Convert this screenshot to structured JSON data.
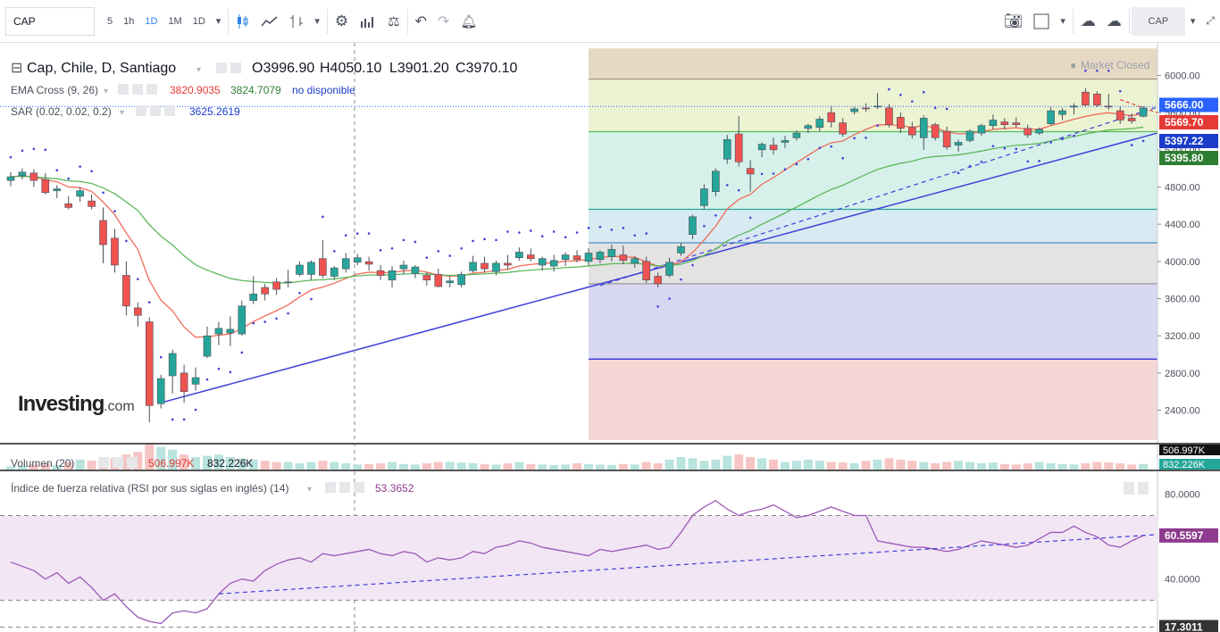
{
  "toolbar": {
    "symbol": "CAP",
    "intervals": [
      "5",
      "1h",
      "1D",
      "1M",
      "1D"
    ],
    "active_interval": "1D",
    "right_symbol": "CAP",
    "icons": [
      "candles-icon",
      "line-chart-icon",
      "bars-icon",
      "dropdown-icon",
      "gear-icon",
      "indicators-icon",
      "compare-icon",
      "undo-icon",
      "redo-icon",
      "alert-icon",
      "camera-icon",
      "layout-icon",
      "cloud-load-icon",
      "cloud-save-icon",
      "fullscreen-icon"
    ]
  },
  "legend": {
    "title": "Cap, Chile, D, Santiago",
    "ohlc": {
      "o": "O3996.90",
      "h": "H4050.10",
      "l": "L3901.20",
      "c": "C3970.10"
    },
    "ema_label": "EMA Cross (9, 26)",
    "ema_val1": "3820.9035",
    "ema_val2": "3824.7079",
    "ema_val3": "no disponible",
    "sar_label": "SAR (0.02, 0.02, 0.2)",
    "sar_val": "3625.2619",
    "market_status": "Market Closed",
    "watermark_brand": "Investing",
    "watermark_suffix": ".com"
  },
  "volume_legend": {
    "label": "Volumen (20)",
    "val1": "506.997K",
    "val2": "832.226K"
  },
  "rsi_legend": {
    "label": "Índice de fuerza relativa (RSI por sus siglas en inglés) (14)",
    "value": "53.3652"
  },
  "colors": {
    "up": "#26a69a",
    "down": "#ef5350",
    "ema_fast": "#ef6c5a",
    "ema_slow": "#5cb85c",
    "sar": "#3f3fd9",
    "trend": "#3f3fd9",
    "rsi": "#9b59b6"
  },
  "chart_data": [
    {
      "type": "candlestick",
      "title": "Cap, Chile, D, Santiago",
      "y_axis_ticks": [
        "6000.00",
        "5600.00",
        "5200.00",
        "4800.00",
        "4400.00",
        "4000.00",
        "3600.00",
        "3200.00",
        "2800.00",
        "2400.00"
      ],
      "y_tick_values": [
        6000,
        5600,
        5200,
        4800,
        4400,
        4000,
        3600,
        3200,
        2800,
        2400
      ],
      "ylim": [
        2050,
        6350
      ],
      "price_labels": [
        {
          "text": "5666.00",
          "value": 5666,
          "color": "#2962ff"
        },
        {
          "text": "5569.70",
          "value": 5569.7,
          "color": "#e53935"
        },
        {
          "text": "5397.22",
          "value": 5397.22,
          "color": "#1a3cc9"
        },
        {
          "text": "5395.80",
          "value": 5395.8,
          "color": "#2e7d32"
        }
      ],
      "candles": [
        [
          4870,
          4960,
          4810,
          4910
        ],
        [
          4920,
          5000,
          4880,
          4960
        ],
        [
          4950,
          4990,
          4800,
          4870
        ],
        [
          4880,
          4950,
          4720,
          4740
        ],
        [
          4760,
          4820,
          4680,
          4780
        ],
        [
          4620,
          4700,
          4560,
          4580
        ],
        [
          4700,
          4800,
          4640,
          4760
        ],
        [
          4650,
          4720,
          4560,
          4590
        ],
        [
          4440,
          4580,
          3980,
          4180
        ],
        [
          4250,
          4350,
          3880,
          3960
        ],
        [
          3850,
          4000,
          3420,
          3520
        ],
        [
          3500,
          3560,
          3300,
          3420
        ],
        [
          3350,
          3400,
          2270,
          2450
        ],
        [
          2470,
          2780,
          2420,
          2740
        ],
        [
          2770,
          3050,
          2580,
          3010
        ],
        [
          2800,
          2890,
          2480,
          2600
        ],
        [
          2680,
          2860,
          2610,
          2750
        ],
        [
          2980,
          3300,
          2960,
          3200
        ],
        [
          3220,
          3350,
          3100,
          3280
        ],
        [
          3230,
          3410,
          3090,
          3270
        ],
        [
          3220,
          3580,
          3200,
          3520
        ],
        [
          3580,
          3840,
          3540,
          3650
        ],
        [
          3720,
          3760,
          3580,
          3650
        ],
        [
          3780,
          3820,
          3640,
          3700
        ],
        [
          3770,
          3910,
          3720,
          3780
        ],
        [
          3860,
          4000,
          3840,
          3960
        ],
        [
          3860,
          4010,
          3800,
          3990
        ],
        [
          4030,
          4230,
          3820,
          3850
        ],
        [
          3840,
          3950,
          3800,
          3930
        ],
        [
          3920,
          4090,
          3880,
          4030
        ],
        [
          3990,
          4080,
          3960,
          4040
        ],
        [
          3997,
          4050,
          3901,
          3970
        ],
        [
          3900,
          3960,
          3800,
          3850
        ],
        [
          3800,
          3950,
          3720,
          3900
        ],
        [
          3920,
          4010,
          3860,
          3960
        ],
        [
          3870,
          3960,
          3820,
          3940
        ],
        [
          3850,
          3880,
          3740,
          3800
        ],
        [
          3860,
          3920,
          3720,
          3730
        ],
        [
          3770,
          3840,
          3720,
          3790
        ],
        [
          3750,
          3890,
          3720,
          3860
        ],
        [
          3900,
          4060,
          3880,
          3990
        ],
        [
          3980,
          4050,
          3880,
          3920
        ],
        [
          3890,
          4010,
          3850,
          3980
        ],
        [
          3980,
          4070,
          3910,
          3960
        ],
        [
          4040,
          4150,
          4010,
          4100
        ],
        [
          4070,
          4140,
          4000,
          4030
        ],
        [
          3960,
          4050,
          3900,
          4030
        ],
        [
          3950,
          4070,
          3890,
          4010
        ],
        [
          4020,
          4100,
          3950,
          4070
        ],
        [
          4060,
          4120,
          3990,
          4020
        ],
        [
          4000,
          4140,
          3960,
          4090
        ],
        [
          4020,
          4120,
          3980,
          4100
        ],
        [
          4050,
          4180,
          4000,
          4130
        ],
        [
          4070,
          4170,
          3970,
          4010
        ],
        [
          3980,
          4060,
          3930,
          4030
        ],
        [
          4000,
          4050,
          3770,
          3800
        ],
        [
          3840,
          3880,
          3720,
          3760
        ],
        [
          3850,
          4040,
          3830,
          3990
        ],
        [
          4090,
          4200,
          4060,
          4160
        ],
        [
          4290,
          4500,
          4240,
          4480
        ],
        [
          4600,
          4830,
          4560,
          4780
        ],
        [
          4750,
          5000,
          4700,
          4970
        ],
        [
          5100,
          5360,
          5050,
          5310
        ],
        [
          5370,
          5560,
          5020,
          5070
        ],
        [
          5000,
          5090,
          4750,
          4940
        ],
        [
          5200,
          5280,
          5120,
          5260
        ],
        [
          5250,
          5330,
          5150,
          5200
        ],
        [
          5280,
          5350,
          5220,
          5300
        ],
        [
          5330,
          5410,
          5300,
          5380
        ],
        [
          5430,
          5480,
          5380,
          5460
        ],
        [
          5440,
          5560,
          5400,
          5530
        ],
        [
          5600,
          5670,
          5440,
          5500
        ],
        [
          5490,
          5540,
          5340,
          5370
        ],
        [
          5610,
          5660,
          5580,
          5640
        ],
        [
          5650,
          5700,
          5610,
          5640
        ],
        [
          5660,
          5810,
          5640,
          5670
        ],
        [
          5650,
          5690,
          5440,
          5470
        ],
        [
          5550,
          5600,
          5380,
          5430
        ],
        [
          5440,
          5500,
          5320,
          5360
        ],
        [
          5330,
          5570,
          5200,
          5540
        ],
        [
          5470,
          5490,
          5300,
          5330
        ],
        [
          5400,
          5450,
          5200,
          5230
        ],
        [
          5250,
          5310,
          5180,
          5280
        ],
        [
          5300,
          5420,
          5280,
          5400
        ],
        [
          5380,
          5480,
          5350,
          5460
        ],
        [
          5460,
          5580,
          5420,
          5520
        ],
        [
          5500,
          5540,
          5420,
          5470
        ],
        [
          5490,
          5550,
          5440,
          5470
        ],
        [
          5430,
          5470,
          5330,
          5360
        ],
        [
          5380,
          5440,
          5360,
          5420
        ],
        [
          5480,
          5660,
          5460,
          5620
        ],
        [
          5580,
          5650,
          5520,
          5620
        ],
        [
          5660,
          5700,
          5580,
          5670
        ],
        [
          5820,
          5860,
          5660,
          5680
        ],
        [
          5800,
          5830,
          5660,
          5680
        ],
        [
          5670,
          5800,
          5630,
          5660
        ],
        [
          5620,
          5670,
          5480,
          5520
        ],
        [
          5540,
          5590,
          5480,
          5510
        ],
        [
          5560,
          5670,
          5550,
          5650
        ]
      ],
      "rsi_ticks": [
        "80.0000",
        "40.0000"
      ],
      "rsi_tick_values": [
        80,
        40
      ],
      "rsi_levels": [
        70,
        30
      ],
      "rsi_ylim": [
        15,
        90
      ],
      "rsi_labels": [
        {
          "text": "60.5597",
          "value": 60.56,
          "color": "#8e3a8e"
        },
        {
          "text": "17.3011",
          "value": 17.3,
          "color": "#333333"
        }
      ],
      "rsi": [
        48,
        46,
        44,
        40,
        43,
        38,
        41,
        36,
        30,
        33,
        27,
        22,
        20,
        19,
        24,
        25,
        24,
        26,
        33,
        38,
        40,
        39,
        44,
        47,
        49,
        50,
        48,
        52,
        51,
        52,
        53,
        54,
        52,
        51,
        53,
        52,
        48,
        50,
        49,
        50,
        53,
        52,
        55,
        56,
        58,
        57,
        55,
        54,
        53,
        52,
        51,
        54,
        53,
        54,
        55,
        56,
        54,
        55,
        62,
        70,
        74,
        77,
        73,
        70,
        72,
        73,
        75,
        72,
        69,
        70,
        72,
        74,
        72,
        70,
        70,
        58,
        57,
        56,
        55,
        55,
        54,
        53,
        54,
        56,
        58,
        57,
        56,
        55,
        56,
        59,
        62,
        62,
        65,
        62,
        60,
        56,
        55,
        58,
        60.56
      ],
      "volume": [
        0.12,
        0.15,
        0.2,
        0.25,
        0.18,
        0.3,
        0.4,
        0.35,
        0.5,
        0.45,
        0.6,
        0.7,
        1,
        0.9,
        0.8,
        0.6,
        0.5,
        0.55,
        0.6,
        0.5,
        0.45,
        0.4,
        0.35,
        0.3,
        0.3,
        0.25,
        0.3,
        0.35,
        0.3,
        0.25,
        0.2,
        0.22,
        0.25,
        0.3,
        0.22,
        0.2,
        0.25,
        0.3,
        0.3,
        0.28,
        0.25,
        0.22,
        0.2,
        0.25,
        0.3,
        0.22,
        0.2,
        0.18,
        0.2,
        0.25,
        0.22,
        0.2,
        0.18,
        0.22,
        0.2,
        0.3,
        0.25,
        0.4,
        0.5,
        0.45,
        0.35,
        0.4,
        0.55,
        0.6,
        0.5,
        0.45,
        0.4,
        0.3,
        0.35,
        0.4,
        0.35,
        0.3,
        0.28,
        0.25,
        0.35,
        0.4,
        0.45,
        0.4,
        0.35,
        0.3,
        0.25,
        0.3,
        0.35,
        0.3,
        0.25,
        0.28,
        0.22,
        0.2,
        0.25,
        0.3,
        0.25,
        0.22,
        0.2,
        0.25,
        0.3,
        0.28,
        0.25,
        0.2,
        0.22
      ]
    }
  ]
}
